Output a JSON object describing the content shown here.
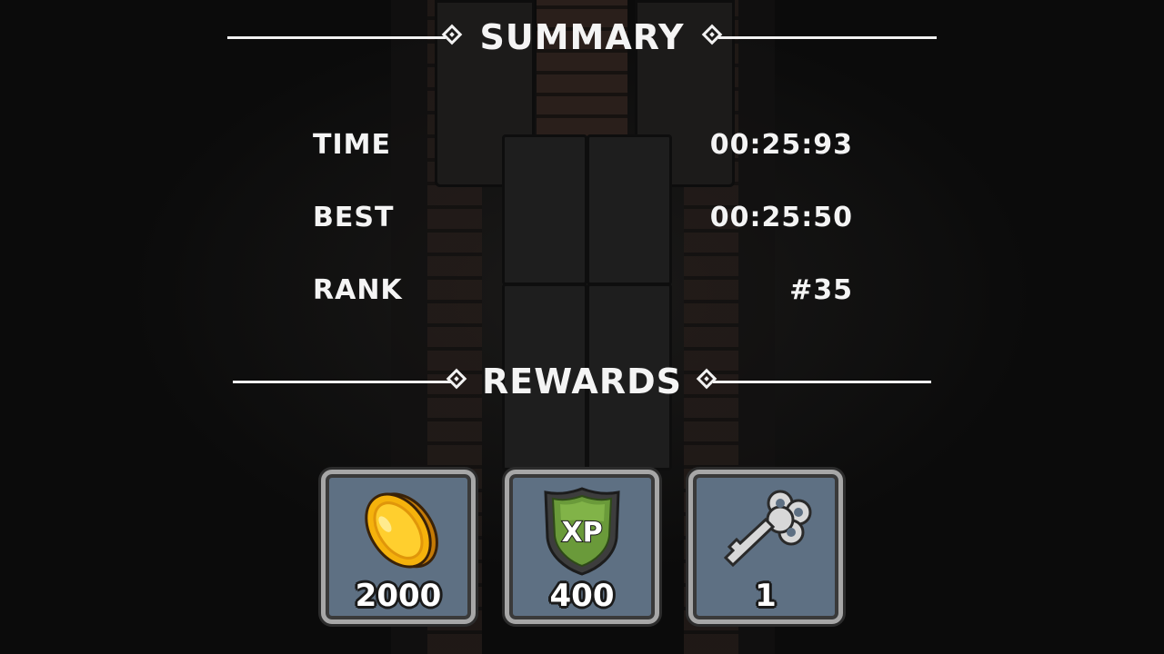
{
  "summary": {
    "title": "SUMMARY",
    "rows": [
      {
        "label": "TIME",
        "value": "00:25:93"
      },
      {
        "label": "BEST",
        "value": "00:25:50"
      },
      {
        "label": "RANK",
        "value": "#35"
      }
    ]
  },
  "rewards": {
    "title": "REWARDS",
    "items": [
      {
        "icon": "gold-coin-icon",
        "amount": "2000"
      },
      {
        "icon": "xp-shield-icon",
        "badge": "XP",
        "amount": "400"
      },
      {
        "icon": "key-icon",
        "amount": "1"
      }
    ]
  },
  "colors": {
    "text": "#f4f4f4",
    "card_fill": "#5e7083",
    "card_border": "#a7a7a7",
    "coin": "#f5b20c",
    "xp_shield": "#6a9a3a"
  }
}
